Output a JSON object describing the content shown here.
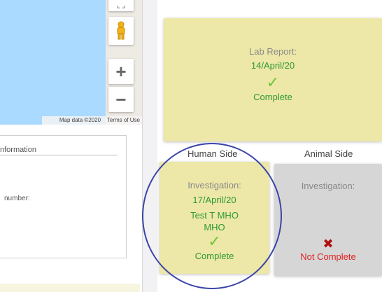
{
  "map": {
    "zoom_in_label": "+",
    "zoom_out_label": "−",
    "attribution_data": "Map data ©2020",
    "attribution_terms": "Terms of Use",
    "fullscreen_icon": "fullscreen-icon",
    "pegman_icon": "pegman-icon"
  },
  "form": {
    "heading": "nformation",
    "number_label": "number:"
  },
  "lab_report": {
    "label": "Lab Report:",
    "date": "14/April/20",
    "check": "✓",
    "status": "Complete"
  },
  "sides": {
    "human": "Human Side",
    "animal": "Animal Side"
  },
  "human_investigation": {
    "label": "Investigation:",
    "date": "17/April/20",
    "name_line1": "Test T MHO",
    "name_line2": "MHO",
    "check": "✓",
    "status": "Complete"
  },
  "animal_investigation": {
    "label": "Investigation:",
    "mark": "✖",
    "status": "Not Complete"
  },
  "colors": {
    "map_water": "#aadaff",
    "card_yellow": "#ede7a8",
    "card_grey": "#d6d6d6",
    "complete_green": "#2e9a2e",
    "not_complete_red": "#e02020",
    "highlight_circle": "#3a45a8"
  }
}
